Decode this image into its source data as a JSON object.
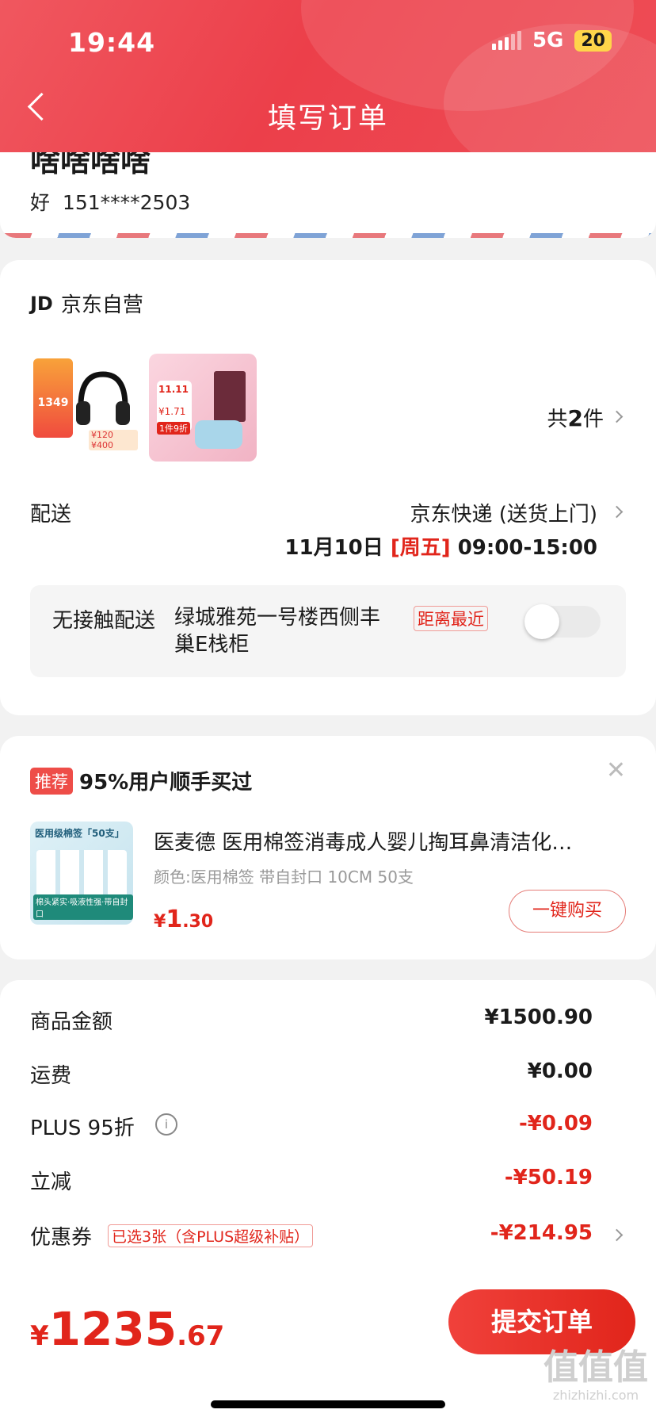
{
  "status_bar": {
    "time": "19:44",
    "network": "5G",
    "battery": "20"
  },
  "header": {
    "title": "填写订单"
  },
  "address": {
    "name": "啥啥啥啥",
    "recipient": "好",
    "phone": "151****2503"
  },
  "shop": {
    "logo": "JD",
    "name": "京东自营"
  },
  "items_summary": {
    "prefix": "共",
    "count": "2",
    "suffix": "件"
  },
  "product_thumbs": [
    {
      "labels": [
        "1349",
        "¥120",
        "¥400"
      ],
      "colors": [
        "#f04b3e",
        "#111111"
      ]
    },
    {
      "labels": [
        "11.11",
        "¥1.71",
        "1件9折"
      ],
      "colors": [
        "#f7c6d2",
        "#6b2b3a"
      ]
    }
  ],
  "delivery": {
    "label": "配送",
    "method": "京东快递 (送货上门)",
    "date": "11月10日",
    "weekday": "[周五]",
    "time": "09:00-15:00"
  },
  "contactless": {
    "label": "无接触配送",
    "location": "绿城雅苑一号楼西侧丰巢E栈柜",
    "tag": "距离最近",
    "enabled": false
  },
  "recommend": {
    "tag": "推荐",
    "headline": "95%用户顺手买过",
    "product_name": "医麦德 医用棉签消毒成人婴儿掏耳鼻清洁化…",
    "spec": "颜色:医用棉签 带自封口 10CM 50支",
    "price_symbol": "¥",
    "price_int": "1",
    "price_dec": ".30",
    "buy_label": "一键购买",
    "thumb_title": "医用级棉签「50支」",
    "thumb_caption": "棉头紧实·吸液性强·带自封口"
  },
  "costs": [
    {
      "label": "商品金额",
      "value": "¥1500.90",
      "color": "#1a1a1a"
    },
    {
      "label": "运费",
      "value": "¥0.00",
      "color": "#1a1a1a"
    },
    {
      "label": "PLUS 95折",
      "value": "-¥0.09",
      "color": "#e1251b",
      "info": true
    },
    {
      "label": "立减",
      "value": "-¥50.19",
      "color": "#e1251b"
    },
    {
      "label": "优惠券",
      "value": "-¥214.95",
      "color": "#e1251b",
      "tag": "已选3张（含PLUS超级补贴）"
    }
  ],
  "footer": {
    "currency": "¥",
    "total_int": "1235",
    "total_dec": ".67",
    "submit": "提交订单"
  },
  "watermark": {
    "big": "值值值",
    "small": "zhizhizhi.com"
  },
  "colors": {
    "brand_red": "#e1251b",
    "header_red": "#ec3f4a"
  }
}
